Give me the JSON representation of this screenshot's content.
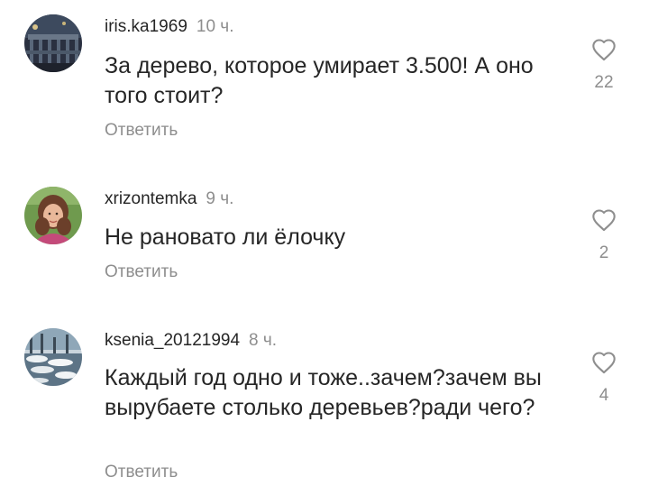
{
  "comments": [
    {
      "username": "iris.ka1969",
      "time": "10 ч.",
      "text": "За дерево, которое умирает 3.500! А оно того стоит?",
      "reply_label": "Ответить",
      "likes": "22",
      "like_icon": "heart-outline-icon"
    },
    {
      "username": "xrizontemka",
      "time": "9 ч.",
      "text": "Не рановато ли ёлочку",
      "reply_label": "Ответить",
      "likes": "2",
      "like_icon": "heart-outline-icon"
    },
    {
      "username": "ksenia_20121994",
      "time": "8 ч.",
      "text": "Каждый год одно и тоже..зачем?зачем вы вырубаете столько деревьев?ради чего?",
      "reply_label": "Ответить",
      "likes": "4",
      "like_icon": "heart-outline-icon"
    }
  ],
  "colors": {
    "text_primary": "#262626",
    "text_secondary": "#8e8e8e",
    "background": "#ffffff"
  }
}
